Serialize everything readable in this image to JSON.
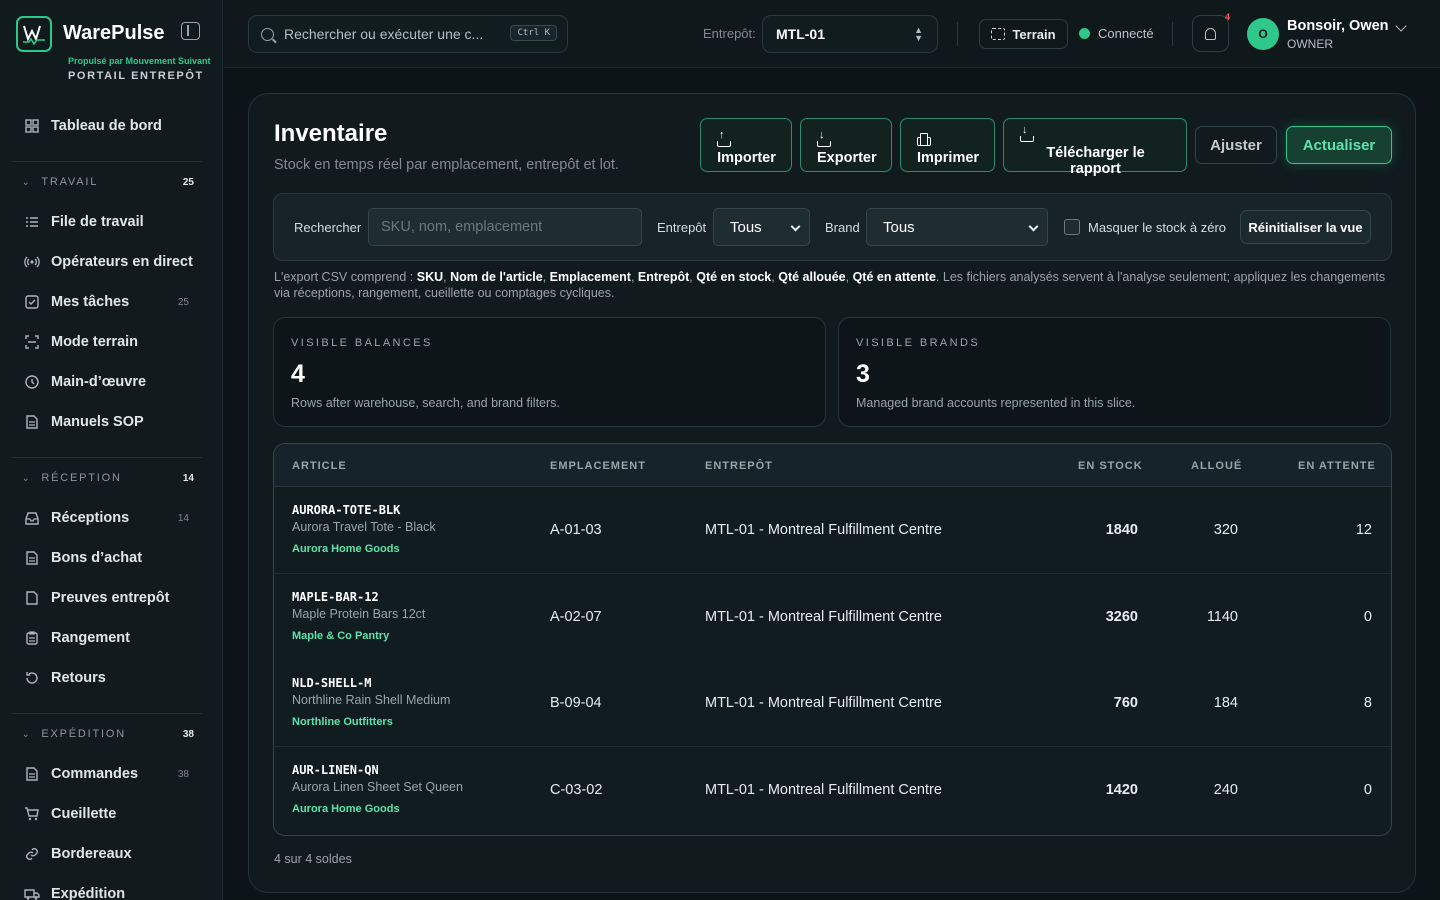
{
  "brand": {
    "name": "WarePulse",
    "sub": "Propulsé par Mouvement Suivant",
    "portal": "PORTAIL ENTREPÔT"
  },
  "sidebar": {
    "top": [
      {
        "label": "Tableau de bord",
        "icon": "grid-icon"
      }
    ],
    "sections": [
      {
        "title": "TRAVAIL",
        "count": "25",
        "items": [
          {
            "label": "File de travail",
            "icon": "list-icon",
            "count": ""
          },
          {
            "label": "Opérateurs en direct",
            "icon": "broadcast-icon",
            "count": ""
          },
          {
            "label": "Mes tâches",
            "icon": "checkbox-icon",
            "count": "25"
          },
          {
            "label": "Mode terrain",
            "icon": "scan-icon",
            "count": ""
          },
          {
            "label": "Main-d’œuvre",
            "icon": "clock-icon",
            "count": ""
          },
          {
            "label": "Manuels SOP",
            "icon": "document-icon",
            "count": ""
          }
        ]
      },
      {
        "title": "RÉCEPTION",
        "count": "14",
        "items": [
          {
            "label": "Réceptions",
            "icon": "inbox-icon",
            "count": "14"
          },
          {
            "label": "Bons d’achat",
            "icon": "document-icon",
            "count": ""
          },
          {
            "label": "Preuves entrepôt",
            "icon": "file-icon",
            "count": ""
          },
          {
            "label": "Rangement",
            "icon": "clipboard-icon",
            "count": ""
          },
          {
            "label": "Retours",
            "icon": "rotate-icon",
            "count": ""
          }
        ]
      },
      {
        "title": "EXPÉDITION",
        "count": "38",
        "items": [
          {
            "label": "Commandes",
            "icon": "document-icon",
            "count": "38"
          },
          {
            "label": "Cueillette",
            "icon": "cart-icon",
            "count": ""
          },
          {
            "label": "Bordereaux",
            "icon": "link-icon",
            "count": ""
          },
          {
            "label": "Expédition",
            "icon": "truck-icon",
            "count": ""
          }
        ]
      }
    ]
  },
  "topbar": {
    "search_placeholder": "Rechercher ou exécuter une c...",
    "shortcut": "Ctrl K",
    "warehouse_label": "Entrepôt:",
    "warehouse_value": "MTL-01",
    "terrain_label": "Terrain",
    "status": "Connecté",
    "notif_count": "4",
    "avatar_initial": "O",
    "user_greeting": "Bonsoir, Owen",
    "user_role": "OWNER"
  },
  "page": {
    "title": "Inventaire",
    "subtitle": "Stock en temps réel par emplacement, entrepôt et lot.",
    "actions": [
      "Importer",
      "Exporter",
      "Imprimer",
      "Télécharger le rapport"
    ],
    "ajuster": "Ajuster",
    "actualiser": "Actualiser"
  },
  "filters": {
    "search_label": "Rechercher",
    "search_placeholder": "SKU, nom, emplacement",
    "warehouse_label": "Entrepôt",
    "warehouse_value": "Tous",
    "brand_label": "Brand",
    "brand_value": "Tous",
    "hide_zero": "Masquer le stock à zéro",
    "reset": "Réinitialiser la vue"
  },
  "note": {
    "prefix": "L'export CSV comprend :",
    "fields": [
      "SKU",
      "Nom de l'article",
      "Emplacement",
      "Entrepôt",
      "Qté en stock",
      "Qté allouée",
      "Qté en attente"
    ],
    "suffix": "Les fichiers analysés servent à l'analyse seulement; appliquez les changements via réceptions, rangement, cueillette ou comptages cycliques."
  },
  "stats": [
    {
      "label": "VISIBLE BALANCES",
      "value": "4",
      "desc": "Rows after warehouse, search, and brand filters."
    },
    {
      "label": "VISIBLE BRANDS",
      "value": "3",
      "desc": "Managed brand accounts represented in this slice."
    }
  ],
  "table": {
    "headers": {
      "article": "ARTICLE",
      "location": "EMPLACEMENT",
      "warehouse": "ENTREPÔT",
      "stock": "EN STOCK",
      "allocated": "ALLOUÉ",
      "pending": "EN ATTENTE"
    },
    "rows": [
      {
        "sku": "AURORA-TOTE-BLK",
        "name": "Aurora Travel Tote - Black",
        "brand": "Aurora Home Goods",
        "location": "A-01-03",
        "warehouse": "MTL-01 - Montreal Fulfillment Centre",
        "stock": "1840",
        "allocated": "320",
        "pending": "12"
      },
      {
        "sku": "MAPLE-BAR-12",
        "name": "Maple Protein Bars 12ct",
        "brand": "Maple & Co Pantry",
        "location": "A-02-07",
        "warehouse": "MTL-01 - Montreal Fulfillment Centre",
        "stock": "3260",
        "allocated": "1140",
        "pending": "0"
      },
      {
        "sku": "NLD-SHELL-M",
        "name": "Northline Rain Shell Medium",
        "brand": "Northline Outfitters",
        "location": "B-09-04",
        "warehouse": "MTL-01 - Montreal Fulfillment Centre",
        "stock": "760",
        "allocated": "184",
        "pending": "8"
      },
      {
        "sku": "AUR-LINEN-QN",
        "name": "Aurora Linen Sheet Set Queen",
        "brand": "Aurora Home Goods",
        "location": "C-03-02",
        "warehouse": "MTL-01 - Montreal Fulfillment Centre",
        "stock": "1420",
        "allocated": "240",
        "pending": "0"
      }
    ],
    "footer": "4 sur 4 soldes"
  },
  "colors": {
    "accent": "#2ec98a",
    "accent_text": "#5ee3aa",
    "background": "#0c1417",
    "panel": "#111b1e",
    "alert": "#ff5560"
  }
}
